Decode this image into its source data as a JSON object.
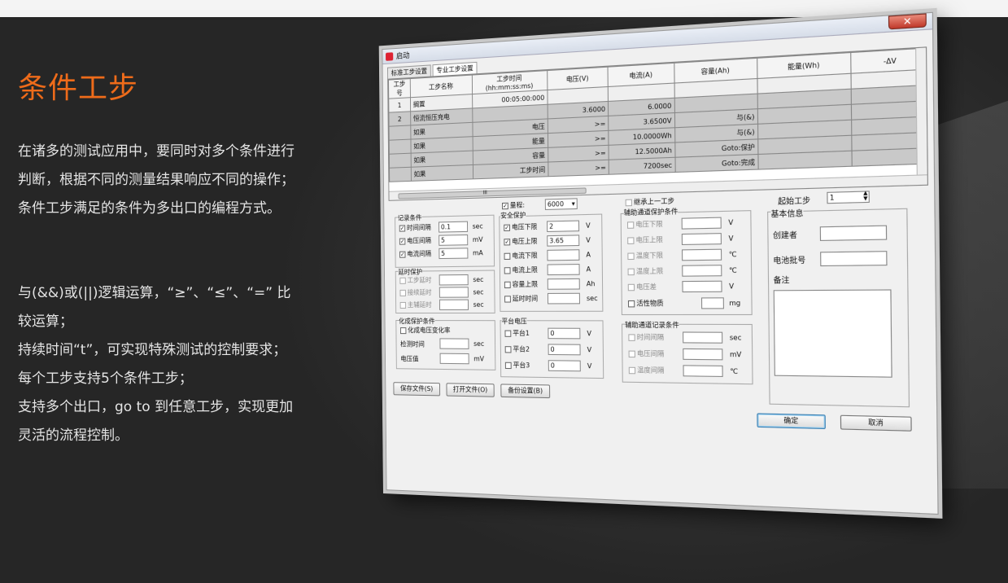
{
  "heading": "条件工步",
  "description": "在诸多的测试应用中，要同时对多个条件进行判断，根据不同的测量结果响应不同的操作；条件工步满足的条件为多出口的编程方式。",
  "features": [
    "与(&&)或(||)逻辑运算，“≥”、“≤”、“=” 比较运算；",
    "持续时间“t”，可实现特殊测试的控制要求；",
    "每个工步支持5个条件工步；",
    "支持多个出口，go to 到任意工步，实现更加灵活的流程控制。"
  ],
  "dialog": {
    "title": "启动",
    "close": "✕",
    "tabs": [
      "标准工步设置",
      "专业工步设置"
    ],
    "columns": [
      "工步号",
      "工步名称",
      "工步时间(hh:mm:ss:ms)",
      "电压(V)",
      "电流(A)",
      "容量(Ah)",
      "能量(Wh)",
      "-ΔV"
    ],
    "rows": [
      [
        "1",
        "搁置",
        "00:05:00:000",
        "",
        "",
        "",
        "",
        ""
      ],
      [
        "2",
        "恒流恒压充电",
        "",
        "3.6000",
        "6.0000",
        "",
        "",
        ""
      ],
      [
        "",
        "如果",
        "电压",
        ">=",
        "3.6500V",
        "与(&)",
        "",
        ""
      ],
      [
        "",
        "如果",
        "能量",
        ">=",
        "10.0000Wh",
        "与(&)",
        "",
        ""
      ],
      [
        "",
        "如果",
        "容量",
        ">=",
        "12.5000Ah",
        "Goto:保护",
        "",
        ""
      ],
      [
        "",
        "如果",
        "工步时间",
        ">=",
        "7200sec",
        "Goto:完成",
        "",
        ""
      ]
    ],
    "scroll_marker": "III",
    "record": {
      "title": "记录条件",
      "items": [
        {
          "label": "时间间隔",
          "value": "0.1",
          "unit": "sec"
        },
        {
          "label": "电压间隔",
          "value": "5",
          "unit": "mV"
        },
        {
          "label": "电流间隔",
          "value": "5",
          "unit": "mA"
        }
      ]
    },
    "delay": {
      "title": "延时保护",
      "items": [
        {
          "label": "工步延时",
          "unit": "sec"
        },
        {
          "label": "接续延时",
          "unit": "sec"
        },
        {
          "label": "主辅延时",
          "unit": "sec"
        }
      ]
    },
    "formation": {
      "title": "化成保护条件",
      "check": "化成电压变化率",
      "items": [
        {
          "label": "检测时间",
          "unit": "sec"
        },
        {
          "label": "电压值",
          "unit": "mV"
        }
      ]
    },
    "range": {
      "label": "量程:",
      "value": "6000"
    },
    "safety": {
      "title": "安全保护",
      "items": [
        {
          "label": "电压下限",
          "value": "2",
          "unit": "V",
          "checked": true
        },
        {
          "label": "电压上限",
          "value": "3.65",
          "unit": "V",
          "checked": true
        },
        {
          "label": "电流下限",
          "value": "",
          "unit": "A",
          "checked": false
        },
        {
          "label": "电流上限",
          "value": "",
          "unit": "A",
          "checked": false
        },
        {
          "label": "容量上限",
          "value": "",
          "unit": "Ah",
          "checked": false
        },
        {
          "label": "延时时间",
          "value": "",
          "unit": "sec",
          "checked": false
        }
      ]
    },
    "plateau": {
      "title": "平台电压",
      "items": [
        {
          "label": "平台1",
          "value": "0",
          "unit": "V"
        },
        {
          "label": "平台2",
          "value": "0",
          "unit": "V"
        },
        {
          "label": "平台3",
          "value": "0",
          "unit": "V"
        }
      ]
    },
    "inherit": "继承上一工步",
    "aux_protect": {
      "title": "辅助通道保护条件",
      "items": [
        {
          "label": "电压下限",
          "unit": "V"
        },
        {
          "label": "电压上限",
          "unit": "V"
        },
        {
          "label": "温度下限",
          "unit": "℃"
        },
        {
          "label": "温度上限",
          "unit": "℃"
        },
        {
          "label": "电压差",
          "unit": "V"
        }
      ],
      "active": {
        "label": "活性物质",
        "unit": "mg"
      }
    },
    "aux_record": {
      "title": "辅助通道记录条件",
      "items": [
        {
          "label": "时间间隔",
          "unit": "sec"
        },
        {
          "label": "电压间隔",
          "unit": "mV"
        },
        {
          "label": "温度间隔",
          "unit": "℃"
        }
      ]
    },
    "start_step": {
      "label": "起始工步",
      "value": "1"
    },
    "basic": {
      "title": "基本信息",
      "creator": "创建者",
      "batch": "电池批号",
      "remark": "备注"
    },
    "buttons": {
      "save": "保存文件(S)",
      "open": "打开文件(O)",
      "backup": "备份设置(B)",
      "ok": "确定",
      "cancel": "取消"
    }
  }
}
